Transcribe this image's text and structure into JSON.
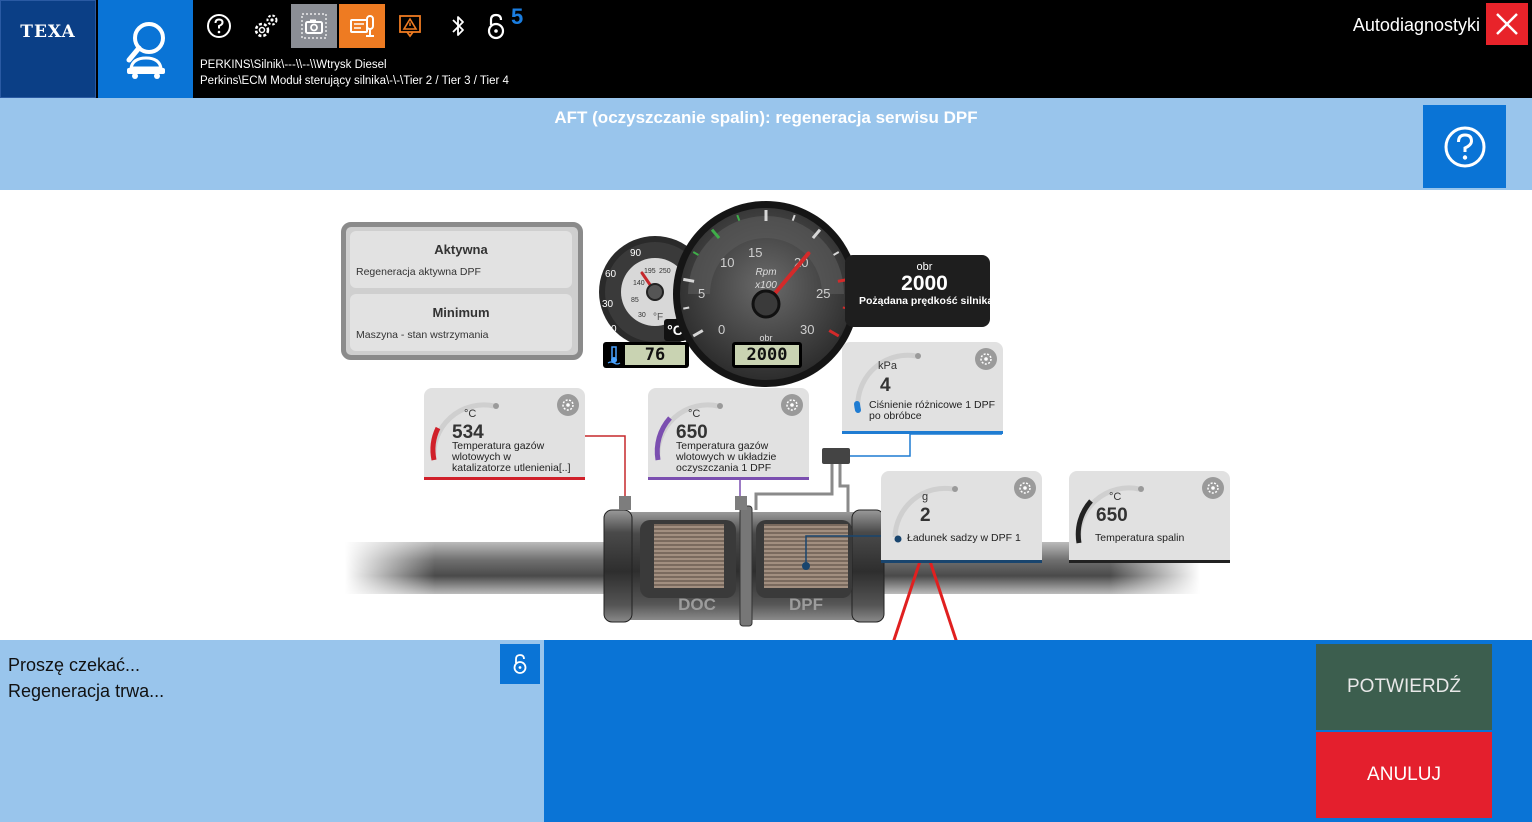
{
  "topbar": {
    "logo_text": "TEXA",
    "lock_count": "5",
    "path_line1": "PERKINS\\Silnik\\---\\\\--\\\\Wtrysk Diesel",
    "path_line2": "Perkins\\ECM Moduł sterujący silnika\\-\\-\\Tier 2 / Tier 3 / Tier 4",
    "mode_title": "Autodiagnostyki",
    "icons": [
      "help-circle-icon",
      "gears-icon",
      "screenshot-camera-icon",
      "diagnostic-report-icon",
      "warning-triangle-icon",
      "bluetooth-icon",
      "padlock-icon"
    ]
  },
  "titlebar": {
    "title": "AFT (oczyszczanie spalin): regeneracja serwisu DPF"
  },
  "status": {
    "box1_title": "Aktywna",
    "box1_sub": "Regeneracja aktywna DPF",
    "box2_title": "Minimum",
    "box2_sub": "Maszyna - stan wstrzymania"
  },
  "gauges": {
    "temp": {
      "scale_c": [
        "0",
        "30",
        "60",
        "90"
      ],
      "scale_f": [
        "30",
        "85",
        "140",
        "195",
        "250"
      ],
      "unit_f": "°F",
      "unit_c": "°C",
      "lcd": "76"
    },
    "rpm": {
      "scale": [
        "0",
        "5",
        "10",
        "15",
        "20",
        "25",
        "30"
      ],
      "label1": "Rpm",
      "label2": "x100",
      "lcd_unit": "obr",
      "lcd": "2000",
      "needle_value": 20
    },
    "rpm_readout": {
      "unit": "obr",
      "value": "2000",
      "desc": "Pożądana prędkość silnika"
    }
  },
  "sensors": {
    "doc_temp": {
      "unit": "°C",
      "value": "534",
      "desc1": "Temperatura gazów",
      "desc2": "wlotowych w",
      "desc3": "katalizatorze utlenienia[..]",
      "color": "#d0202a"
    },
    "dpf_temp": {
      "unit": "°C",
      "value": "650",
      "desc1": "Temperatura gazów",
      "desc2": "wlotowych w układzie",
      "desc3": "oczyszczania 1 DPF",
      "color": "#7b4fb0"
    },
    "pressure": {
      "unit": "kPa",
      "value": "4",
      "desc1": "Ciśnienie różnicowe 1 DPF",
      "desc2": "po obróbce",
      "color": "#1f7cd2"
    },
    "soot": {
      "unit": "g",
      "value": "2",
      "desc1": "Ładunek sadzy w DPF 1",
      "color": "#19456e"
    },
    "exhaust_temp": {
      "unit": "°C",
      "value": "650",
      "desc1": "Temperatura spalin",
      "color": "#222222"
    }
  },
  "pipe": {
    "doc_label": "DOC",
    "dpf_label": "DPF"
  },
  "bottom": {
    "msg1": "Proszę czekać...",
    "msg2": "Regeneracja trwa...",
    "confirm_label": "POTWIERDŹ",
    "cancel_label": "ANULUJ"
  },
  "colors": {
    "accent_blue": "#0a74d6",
    "light_blue": "#99c5ec",
    "cancel_red": "#e41f2d",
    "confirm_green": "#3c5e4e",
    "annotation_red": "#e02020"
  }
}
